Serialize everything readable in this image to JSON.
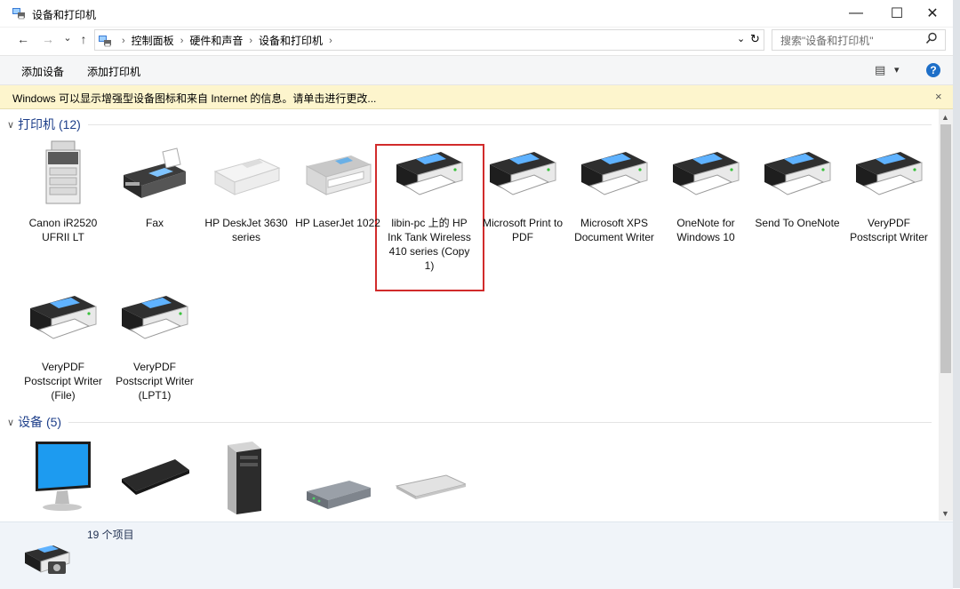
{
  "window": {
    "title": "设备和打印机",
    "controls": {
      "minimize": "—",
      "maximize": "☐",
      "close": "✕"
    }
  },
  "nav": {
    "back": "←",
    "forward": "→",
    "history": "⌄",
    "up": "↑",
    "breadcrumbs": [
      "控制面板",
      "硬件和声音",
      "设备和打印机"
    ],
    "refresh": "↻",
    "dropdown": "⌄",
    "search_placeholder": "搜索\"设备和打印机\""
  },
  "toolbar": {
    "add_device": "添加设备",
    "add_printer": "添加打印机",
    "view_icon": "▤",
    "view_dropdown": "▾",
    "help": "?"
  },
  "infobar": {
    "text": "Windows 可以显示增强型设备图标和来自 Internet 的信息。请单击进行更改...",
    "close": "×"
  },
  "groups": {
    "printers": {
      "title": "打印机 (12)"
    },
    "devices": {
      "title": "设备 (5)"
    }
  },
  "printers": [
    {
      "label": "Canon iR2520 UFRII LT",
      "icon": "copier-icon"
    },
    {
      "label": "Fax",
      "icon": "fax-icon"
    },
    {
      "label": "HP DeskJet 3630 series",
      "icon": "inkjet-printer-icon"
    },
    {
      "label": "HP LaserJet 1022",
      "icon": "laser-printer-icon"
    },
    {
      "label": "libin-pc 上的 HP Ink Tank Wireless 410 series (Copy 1)",
      "icon": "printer-icon"
    },
    {
      "label": "Microsoft Print to PDF",
      "icon": "printer-icon"
    },
    {
      "label": "Microsoft XPS Document Writer",
      "icon": "printer-icon"
    },
    {
      "label": "OneNote for Windows 10",
      "icon": "printer-icon"
    },
    {
      "label": "Send To OneNote",
      "icon": "printer-icon"
    },
    {
      "label": "VeryPDF Postscript Writer",
      "icon": "printer-icon"
    },
    {
      "label": "VeryPDF Postscript Writer (File)",
      "icon": "printer-icon"
    },
    {
      "label": "VeryPDF Postscript Writer (LPT1)",
      "icon": "printer-icon"
    }
  ],
  "devices": [
    {
      "icon": "monitor-icon"
    },
    {
      "icon": "keyboard-icon"
    },
    {
      "icon": "pc-tower-icon"
    },
    {
      "icon": "network-device-icon"
    },
    {
      "icon": "keyboard-icon"
    }
  ],
  "status": {
    "item_count": "19 个项目"
  },
  "scrollbar": {
    "up": "▲",
    "down": "▼"
  }
}
